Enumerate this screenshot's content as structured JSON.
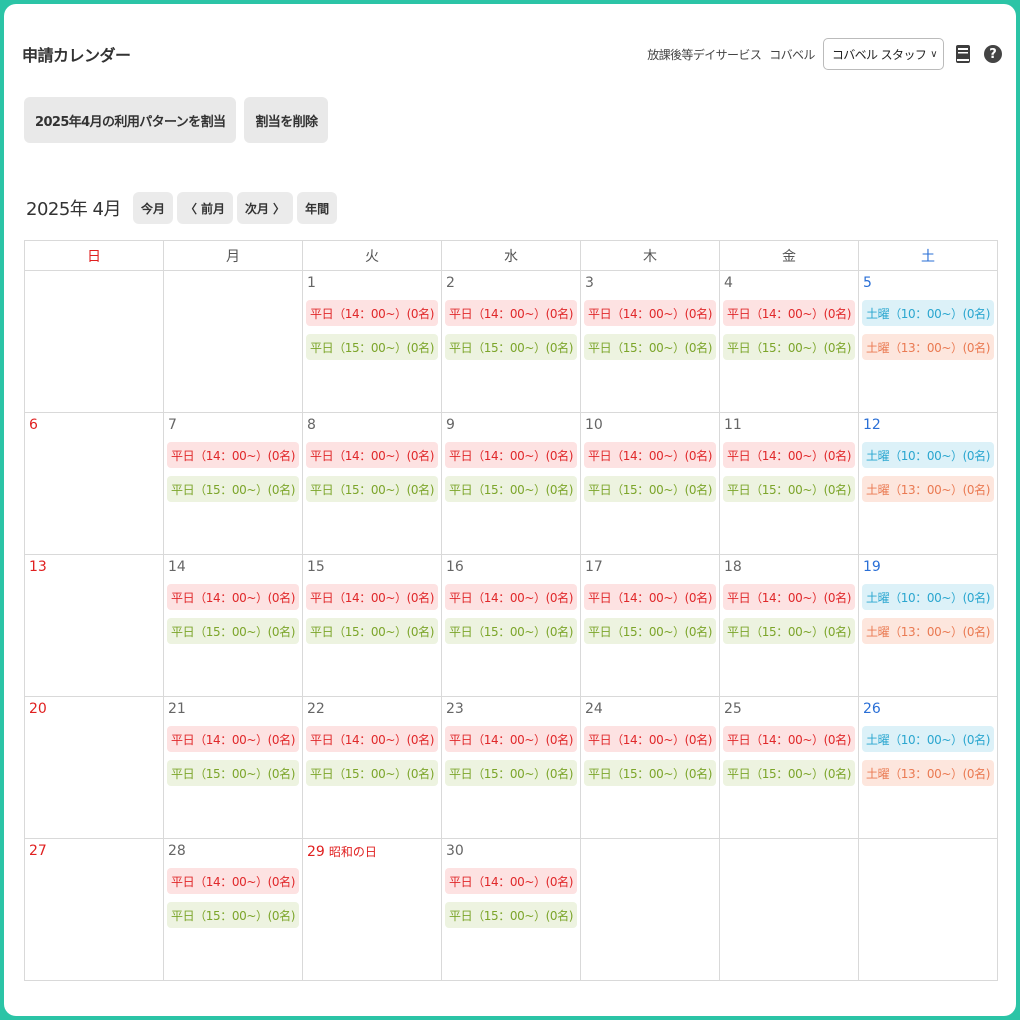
{
  "header": {
    "title": "申請カレンダー",
    "service": "放課後等デイサービス",
    "facility": "コバベル",
    "staff_select": "コバベル スタッフ",
    "manual_icon": "book-icon",
    "help_icon": "question-circle-icon",
    "help_glyph": "?"
  },
  "actions": {
    "assign_pattern": "2025年4月の利用パターンを割当",
    "delete_assignment": "割当を削除"
  },
  "nav": {
    "month_label": "2025年 4月",
    "this_month": "今月",
    "prev_month": "前月",
    "next_month": "次月",
    "year": "年間",
    "prev_glyph": "〈",
    "next_glyph": "〉"
  },
  "weekdays": [
    "日",
    "月",
    "火",
    "水",
    "木",
    "金",
    "土"
  ],
  "colors": {
    "weekday_a_bg": "#fde2e2",
    "weekday_a_text": "#e0282a",
    "weekday_b_bg": "#edf3e0",
    "weekday_b_text": "#7ca52a",
    "sat_a_bg": "#dcf1f8",
    "sat_a_text": "#2aa6cf",
    "sat_b_bg": "#fde6dd",
    "sat_b_text": "#ea7a52",
    "sunday": "#e02020",
    "saturday": "#2a6fd6"
  },
  "slots": {
    "weekday_a": "平日（14：00~）(0名)",
    "weekday_b": "平日（15：00~）(0名)",
    "sat_a": "土曜（10：00~）(0名)",
    "sat_b": "土曜（13：00~）(0名)"
  },
  "weeks": [
    [
      {
        "day": "",
        "dow": "sun",
        "slots": []
      },
      {
        "day": "",
        "dow": "mon",
        "slots": []
      },
      {
        "day": "1",
        "dow": "tue",
        "slots": [
          "weekday_a",
          "weekday_b"
        ]
      },
      {
        "day": "2",
        "dow": "wed",
        "slots": [
          "weekday_a",
          "weekday_b"
        ]
      },
      {
        "day": "3",
        "dow": "thu",
        "slots": [
          "weekday_a",
          "weekday_b"
        ]
      },
      {
        "day": "4",
        "dow": "fri",
        "slots": [
          "weekday_a",
          "weekday_b"
        ]
      },
      {
        "day": "5",
        "dow": "sat",
        "slots": [
          "sat_a",
          "sat_b"
        ]
      }
    ],
    [
      {
        "day": "6",
        "dow": "sun",
        "slots": []
      },
      {
        "day": "7",
        "dow": "mon",
        "slots": [
          "weekday_a",
          "weekday_b"
        ]
      },
      {
        "day": "8",
        "dow": "tue",
        "slots": [
          "weekday_a",
          "weekday_b"
        ]
      },
      {
        "day": "9",
        "dow": "wed",
        "slots": [
          "weekday_a",
          "weekday_b"
        ]
      },
      {
        "day": "10",
        "dow": "thu",
        "slots": [
          "weekday_a",
          "weekday_b"
        ]
      },
      {
        "day": "11",
        "dow": "fri",
        "slots": [
          "weekday_a",
          "weekday_b"
        ]
      },
      {
        "day": "12",
        "dow": "sat",
        "slots": [
          "sat_a",
          "sat_b"
        ]
      }
    ],
    [
      {
        "day": "13",
        "dow": "sun",
        "slots": []
      },
      {
        "day": "14",
        "dow": "mon",
        "slots": [
          "weekday_a",
          "weekday_b"
        ]
      },
      {
        "day": "15",
        "dow": "tue",
        "slots": [
          "weekday_a",
          "weekday_b"
        ]
      },
      {
        "day": "16",
        "dow": "wed",
        "slots": [
          "weekday_a",
          "weekday_b"
        ]
      },
      {
        "day": "17",
        "dow": "thu",
        "slots": [
          "weekday_a",
          "weekday_b"
        ]
      },
      {
        "day": "18",
        "dow": "fri",
        "slots": [
          "weekday_a",
          "weekday_b"
        ]
      },
      {
        "day": "19",
        "dow": "sat",
        "slots": [
          "sat_a",
          "sat_b"
        ]
      }
    ],
    [
      {
        "day": "20",
        "dow": "sun",
        "slots": []
      },
      {
        "day": "21",
        "dow": "mon",
        "slots": [
          "weekday_a",
          "weekday_b"
        ]
      },
      {
        "day": "22",
        "dow": "tue",
        "slots": [
          "weekday_a",
          "weekday_b"
        ]
      },
      {
        "day": "23",
        "dow": "wed",
        "slots": [
          "weekday_a",
          "weekday_b"
        ]
      },
      {
        "day": "24",
        "dow": "thu",
        "slots": [
          "weekday_a",
          "weekday_b"
        ]
      },
      {
        "day": "25",
        "dow": "fri",
        "slots": [
          "weekday_a",
          "weekday_b"
        ]
      },
      {
        "day": "26",
        "dow": "sat",
        "slots": [
          "sat_a",
          "sat_b"
        ]
      }
    ],
    [
      {
        "day": "27",
        "dow": "sun",
        "slots": []
      },
      {
        "day": "28",
        "dow": "mon",
        "slots": [
          "weekday_a",
          "weekday_b"
        ]
      },
      {
        "day": "29",
        "dow": "tue",
        "holiday": "昭和の日",
        "slots": []
      },
      {
        "day": "30",
        "dow": "wed",
        "slots": [
          "weekday_a",
          "weekday_b"
        ]
      },
      {
        "day": "",
        "dow": "thu",
        "slots": []
      },
      {
        "day": "",
        "dow": "fri",
        "slots": []
      },
      {
        "day": "",
        "dow": "sat",
        "slots": []
      }
    ]
  ]
}
